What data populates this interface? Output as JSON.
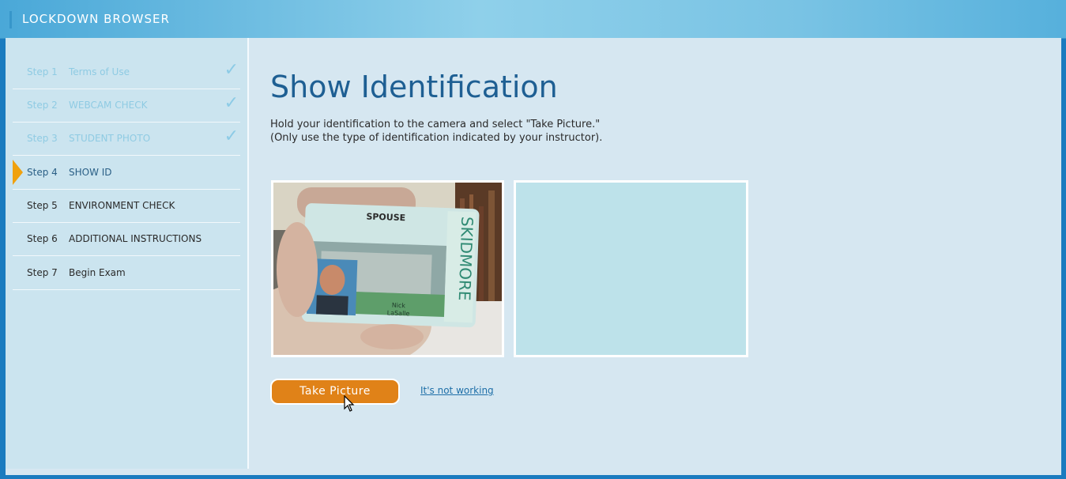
{
  "app": {
    "title": "LOCKDOWN BROWSER"
  },
  "sidebar": {
    "steps": [
      {
        "num": "Step 1",
        "label": "Terms of Use",
        "status": "done"
      },
      {
        "num": "Step 2",
        "label": "WEBCAM CHECK",
        "status": "done"
      },
      {
        "num": "Step 3",
        "label": "STUDENT PHOTO",
        "status": "done"
      },
      {
        "num": "Step 4",
        "label": "SHOW ID",
        "status": "current"
      },
      {
        "num": "Step 5",
        "label": "ENVIRONMENT CHECK",
        "status": "todo"
      },
      {
        "num": "Step 6",
        "label": "ADDITIONAL INSTRUCTIONS",
        "status": "todo"
      },
      {
        "num": "Step 7",
        "label": "Begin Exam",
        "status": "todo"
      }
    ]
  },
  "main": {
    "heading": "Show Identification",
    "instructions": [
      "Hold your identification to the camera and select \"Take Picture.\"",
      "(Only use the type of identification indicated by your instructor)."
    ],
    "id_card": {
      "header": "SPOUSE",
      "brand": "SKIDMORE",
      "name_line1": "Nick",
      "name_line2": "LaSalle"
    },
    "take_picture_label": "Take Picture",
    "not_working_label": "It's not working"
  },
  "colors": {
    "accent": "#e08218",
    "heading": "#1e5f93",
    "current_marker": "#f0a10e",
    "done_step": "#8fcbe3"
  }
}
